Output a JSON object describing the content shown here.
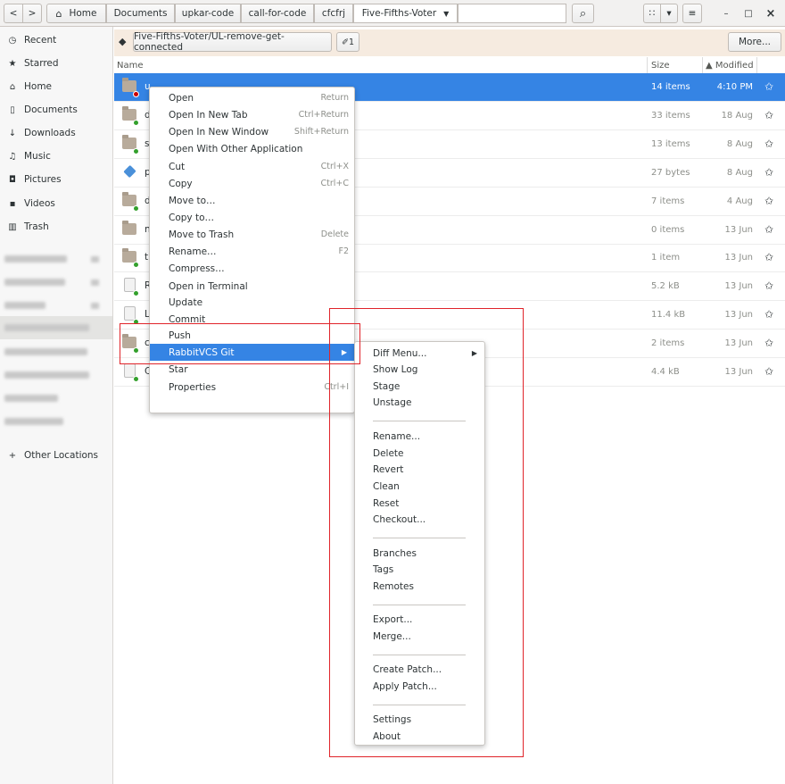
{
  "header": {
    "nav_back": "<",
    "nav_forward": ">",
    "home_crumb_icon": "home-icon",
    "breadcrumbs": [
      "Home",
      "Documents",
      "upkar-code",
      "call-for-code",
      "cfcfrj",
      "Five-Fifths-Voter"
    ],
    "current_crumb_arrow": "▼",
    "search_icon": "⌕",
    "view_grid_icon": "∷",
    "view_dropdown": "▾",
    "hamburger_icon": "≡",
    "win_minimize": "–",
    "win_maximize": "□",
    "win_close": "×"
  },
  "sidebar": {
    "items": [
      {
        "icon": "clock-icon",
        "glyph": "◷",
        "label": "Recent"
      },
      {
        "icon": "star-icon",
        "glyph": "★",
        "label": "Starred"
      },
      {
        "icon": "home-icon",
        "glyph": "⌂",
        "label": "Home"
      },
      {
        "icon": "document-icon",
        "glyph": "▯",
        "label": "Documents"
      },
      {
        "icon": "download-icon",
        "glyph": "↓",
        "label": "Downloads"
      },
      {
        "icon": "music-icon",
        "glyph": "♫",
        "label": "Music"
      },
      {
        "icon": "camera-icon",
        "glyph": "◘",
        "label": "Pictures"
      },
      {
        "icon": "video-icon",
        "glyph": "▪",
        "label": "Videos"
      },
      {
        "icon": "trash-icon",
        "glyph": "▥",
        "label": "Trash"
      }
    ],
    "other_locations": "Other Locations",
    "other_locations_glyph": "+"
  },
  "infobar": {
    "branch_icon_glyph": "◆",
    "branch_label": "Five-Fifths-Voter/UL-remove-get-connected",
    "edit_label": "✐1",
    "more_label": "More..."
  },
  "columns": {
    "name": "Name",
    "size": "Size",
    "modified": "▲ Modified"
  },
  "files": [
    {
      "name": "u",
      "kind": "folder",
      "emblem": "red",
      "size": "14 items",
      "modified": "4:10 PM",
      "selected": true
    },
    {
      "name": "d",
      "kind": "folder",
      "emblem": "green",
      "size": "33 items",
      "modified": "18 Aug"
    },
    {
      "name": "s",
      "kind": "folder",
      "emblem": "green",
      "size": "13 items",
      "modified": "8 Aug"
    },
    {
      "name": "p",
      "kind": "blue",
      "emblem": "none",
      "size": "27 bytes",
      "modified": "8 Aug"
    },
    {
      "name": "d",
      "kind": "folder",
      "emblem": "green",
      "size": "7 items",
      "modified": "4 Aug"
    },
    {
      "name": "n",
      "kind": "folder",
      "emblem": "none",
      "size": "0 items",
      "modified": "13 Jun"
    },
    {
      "name": "t",
      "kind": "folder",
      "emblem": "green",
      "size": "1 item",
      "modified": "13 Jun"
    },
    {
      "name": "R",
      "kind": "doc",
      "emblem": "green",
      "size": "5.2 kB",
      "modified": "13 Jun"
    },
    {
      "name": "L",
      "kind": "doc",
      "emblem": "green",
      "size": "11.4 kB",
      "modified": "13 Jun"
    },
    {
      "name": "c",
      "kind": "folder",
      "emblem": "green",
      "size": "2 items",
      "modified": "13 Jun"
    },
    {
      "name": "C",
      "kind": "doc",
      "emblem": "green",
      "size": "4.4 kB",
      "modified": "13 Jun"
    }
  ],
  "star_glyph": "✩",
  "context_menu": {
    "items": [
      {
        "label": "Open",
        "accel": "Return"
      },
      {
        "label": "Open In New Tab",
        "accel": "Ctrl+Return"
      },
      {
        "label": "Open In New Window",
        "accel": "Shift+Return"
      },
      {
        "label": "Open With Other Application",
        "accel": ""
      },
      {
        "label": "Cut",
        "accel": "Ctrl+X"
      },
      {
        "label": "Copy",
        "accel": "Ctrl+C"
      },
      {
        "label": "Move to…",
        "accel": ""
      },
      {
        "label": "Copy to…",
        "accel": ""
      },
      {
        "label": "Move to Trash",
        "accel": "Delete"
      },
      {
        "label": "Rename…",
        "accel": "F2"
      },
      {
        "label": "Compress…",
        "accel": ""
      },
      {
        "label": "Open in Terminal",
        "accel": ""
      },
      {
        "label": "Update",
        "accel": ""
      },
      {
        "label": "Commit",
        "accel": ""
      },
      {
        "label": "Push",
        "accel": ""
      },
      {
        "label": "RabbitVCS Git",
        "accel": "",
        "submenu": true,
        "arrow": "▶"
      },
      {
        "label": "Star",
        "accel": ""
      },
      {
        "label": "Properties",
        "accel": "Ctrl+I"
      }
    ]
  },
  "submenu": {
    "groups": [
      [
        {
          "label": "Diff Menu...",
          "arrow": "▶"
        },
        {
          "label": "Show Log"
        },
        {
          "label": "Stage"
        },
        {
          "label": "Unstage"
        }
      ],
      [
        {
          "label": "Rename..."
        },
        {
          "label": "Delete"
        },
        {
          "label": "Revert"
        },
        {
          "label": "Clean"
        },
        {
          "label": "Reset"
        },
        {
          "label": "Checkout..."
        }
      ],
      [
        {
          "label": "Branches"
        },
        {
          "label": "Tags"
        },
        {
          "label": "Remotes"
        }
      ],
      [
        {
          "label": "Export..."
        },
        {
          "label": "Merge..."
        }
      ],
      [
        {
          "label": "Create Patch..."
        },
        {
          "label": "Apply Patch..."
        }
      ],
      [
        {
          "label": "Settings"
        },
        {
          "label": "About"
        }
      ]
    ]
  },
  "colors": {
    "accent": "#3584e4",
    "annotation": "#e0242a",
    "infobar": "#f6ebe0"
  }
}
